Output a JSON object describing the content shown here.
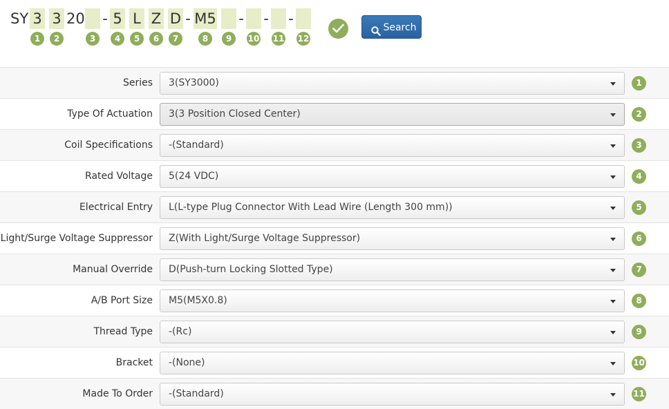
{
  "part_number": {
    "segments": [
      {
        "kind": "static",
        "text": "SY"
      },
      {
        "kind": "box",
        "text": "3",
        "num": "1"
      },
      {
        "kind": "box",
        "text": "3",
        "num": "2"
      },
      {
        "kind": "static",
        "text": "20"
      },
      {
        "kind": "box",
        "text": "",
        "num": "3"
      },
      {
        "kind": "dash",
        "text": "-"
      },
      {
        "kind": "box",
        "text": "5",
        "num": "4"
      },
      {
        "kind": "box",
        "text": "L",
        "num": "5"
      },
      {
        "kind": "box",
        "text": "Z",
        "num": "6"
      },
      {
        "kind": "box",
        "text": "D",
        "num": "7"
      },
      {
        "kind": "dash",
        "text": "-"
      },
      {
        "kind": "box",
        "text": "M5",
        "num": "8"
      },
      {
        "kind": "box",
        "text": "",
        "num": "9"
      },
      {
        "kind": "dash",
        "text": "-"
      },
      {
        "kind": "box",
        "text": "",
        "num": "10"
      },
      {
        "kind": "dash",
        "text": "-"
      },
      {
        "kind": "box",
        "text": "",
        "num": "11"
      },
      {
        "kind": "dash",
        "text": "-"
      },
      {
        "kind": "box",
        "text": "",
        "num": "12"
      }
    ],
    "check_icon": "checkmark-icon",
    "search_label": "Search",
    "search_icon": "search-icon"
  },
  "form": {
    "rows": [
      {
        "label": "Series",
        "value": "3(SY3000)",
        "num": "1"
      },
      {
        "label": "Type Of Actuation",
        "value": "3(3 Position Closed Center)",
        "num": "2"
      },
      {
        "label": "Coil Specifications",
        "value": "-(Standard)",
        "num": "3"
      },
      {
        "label": "Rated Voltage",
        "value": "5(24 VDC)",
        "num": "4"
      },
      {
        "label": "Electrical Entry",
        "value": "L(L-type Plug Connector With Lead Wire (Length 300 mm))",
        "num": "5"
      },
      {
        "label": "Light/Surge Voltage Suppressor",
        "value": "Z(With Light/Surge Voltage Suppressor)",
        "num": "6"
      },
      {
        "label": "Manual Override",
        "value": "D(Push-turn Locking Slotted Type)",
        "num": "7"
      },
      {
        "label": "A/B Port Size",
        "value": "M5(M5X0.8)",
        "num": "8"
      },
      {
        "label": "Thread Type",
        "value": "-(Rc)",
        "num": "9"
      },
      {
        "label": "Bracket",
        "value": "-(None)",
        "num": "10"
      },
      {
        "label": "Made To Order",
        "value": "-(Standard)",
        "num": "11"
      }
    ]
  },
  "colors": {
    "accent_green": "#8fae5b",
    "box_fill": "#e7edc8",
    "button_blue": "#2a62a0"
  }
}
